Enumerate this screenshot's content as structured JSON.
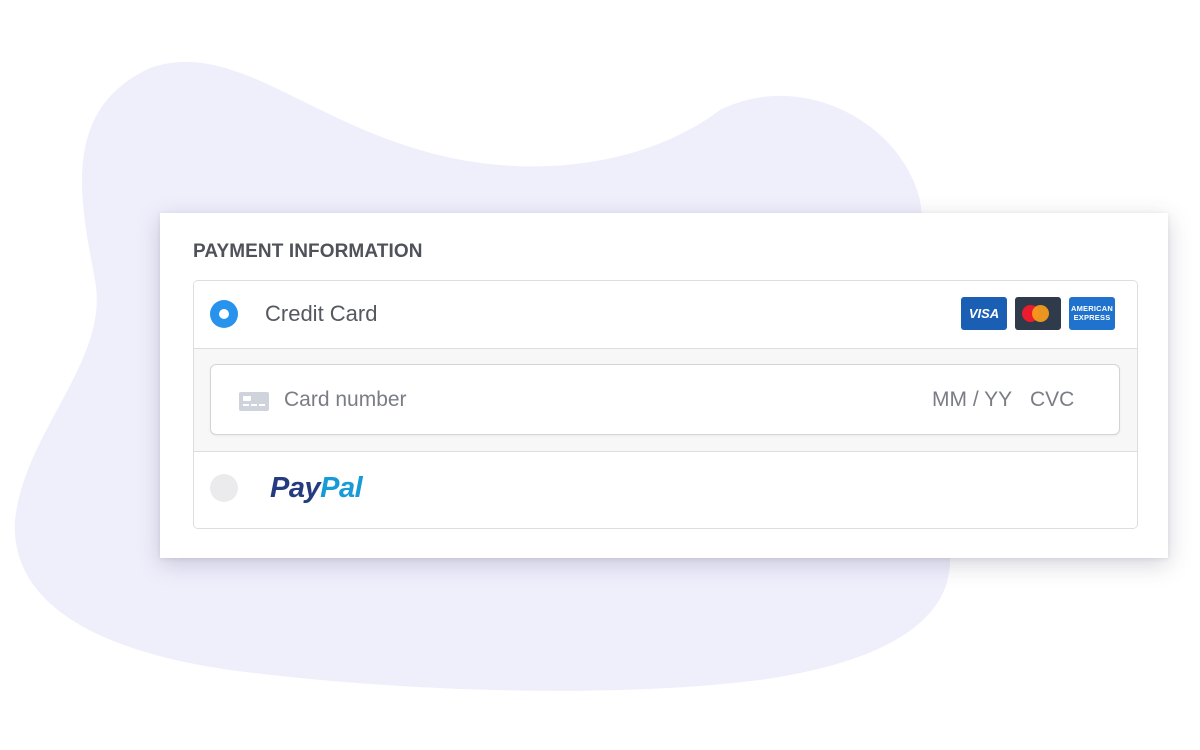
{
  "section": {
    "title": "PAYMENT INFORMATION"
  },
  "credit_card": {
    "label": "Credit Card",
    "selected": true,
    "brands": [
      {
        "name": "visa",
        "label": "VISA",
        "color": "#1a5fb4"
      },
      {
        "name": "mastercard",
        "label": "",
        "color": "#2f3a4a"
      },
      {
        "name": "amex",
        "label_line1": "AMERICAN",
        "label_line2": "EXPRESS",
        "color": "#1f72cd"
      }
    ],
    "card_field": {
      "number_placeholder": "Card number",
      "expiry_placeholder": "MM / YY",
      "cvc_placeholder": "CVC"
    }
  },
  "paypal": {
    "selected": false,
    "logo_part1": "Pay",
    "logo_part2": "Pal"
  },
  "colors": {
    "accent": "#2793ec",
    "background_blob": "#efeffc",
    "paypal_dark": "#253b80",
    "paypal_light": "#179bd7"
  }
}
